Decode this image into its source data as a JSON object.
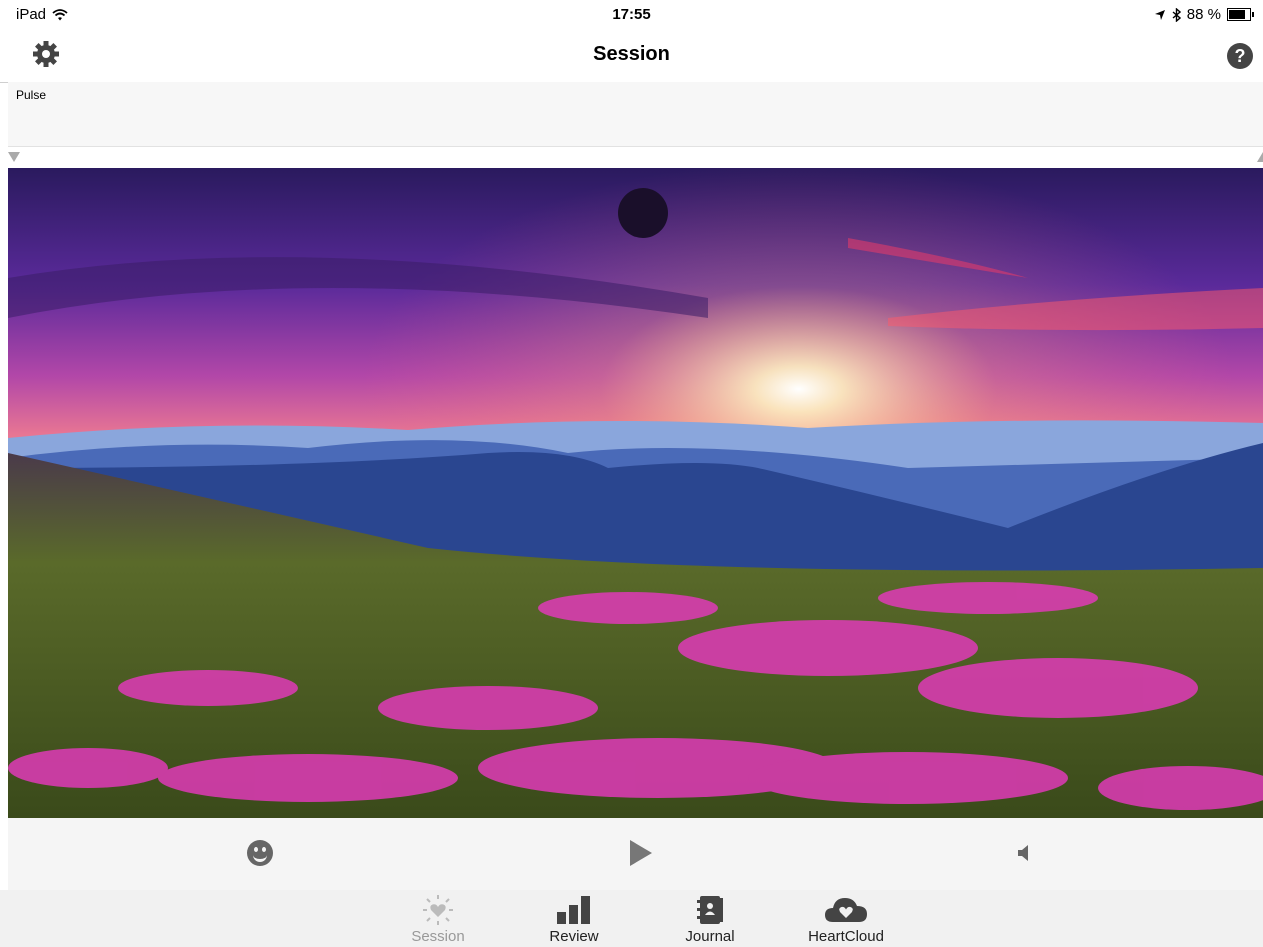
{
  "status_bar": {
    "device": "iPad",
    "time": "17:55",
    "battery_text": "88 %",
    "battery_level": 0.88
  },
  "nav": {
    "title": "Session",
    "settings_icon": "gear-icon",
    "help_icon": "help-icon",
    "help_glyph": "?"
  },
  "pulse": {
    "label": "Pulse"
  },
  "controls": {
    "mood_icon": "smiley-icon",
    "play_icon": "play-icon",
    "volume_icon": "speaker-icon"
  },
  "tabs": [
    {
      "label": "Session",
      "icon": "heart-sparkle-icon",
      "active": true
    },
    {
      "label": "Review",
      "icon": "bar-chart-icon",
      "active": false
    },
    {
      "label": "Journal",
      "icon": "journal-icon",
      "active": false
    },
    {
      "label": "HeartCloud",
      "icon": "heart-cloud-icon",
      "active": false
    }
  ],
  "colors": {
    "tab_active": "#999999",
    "icon_dark": "#444444"
  }
}
